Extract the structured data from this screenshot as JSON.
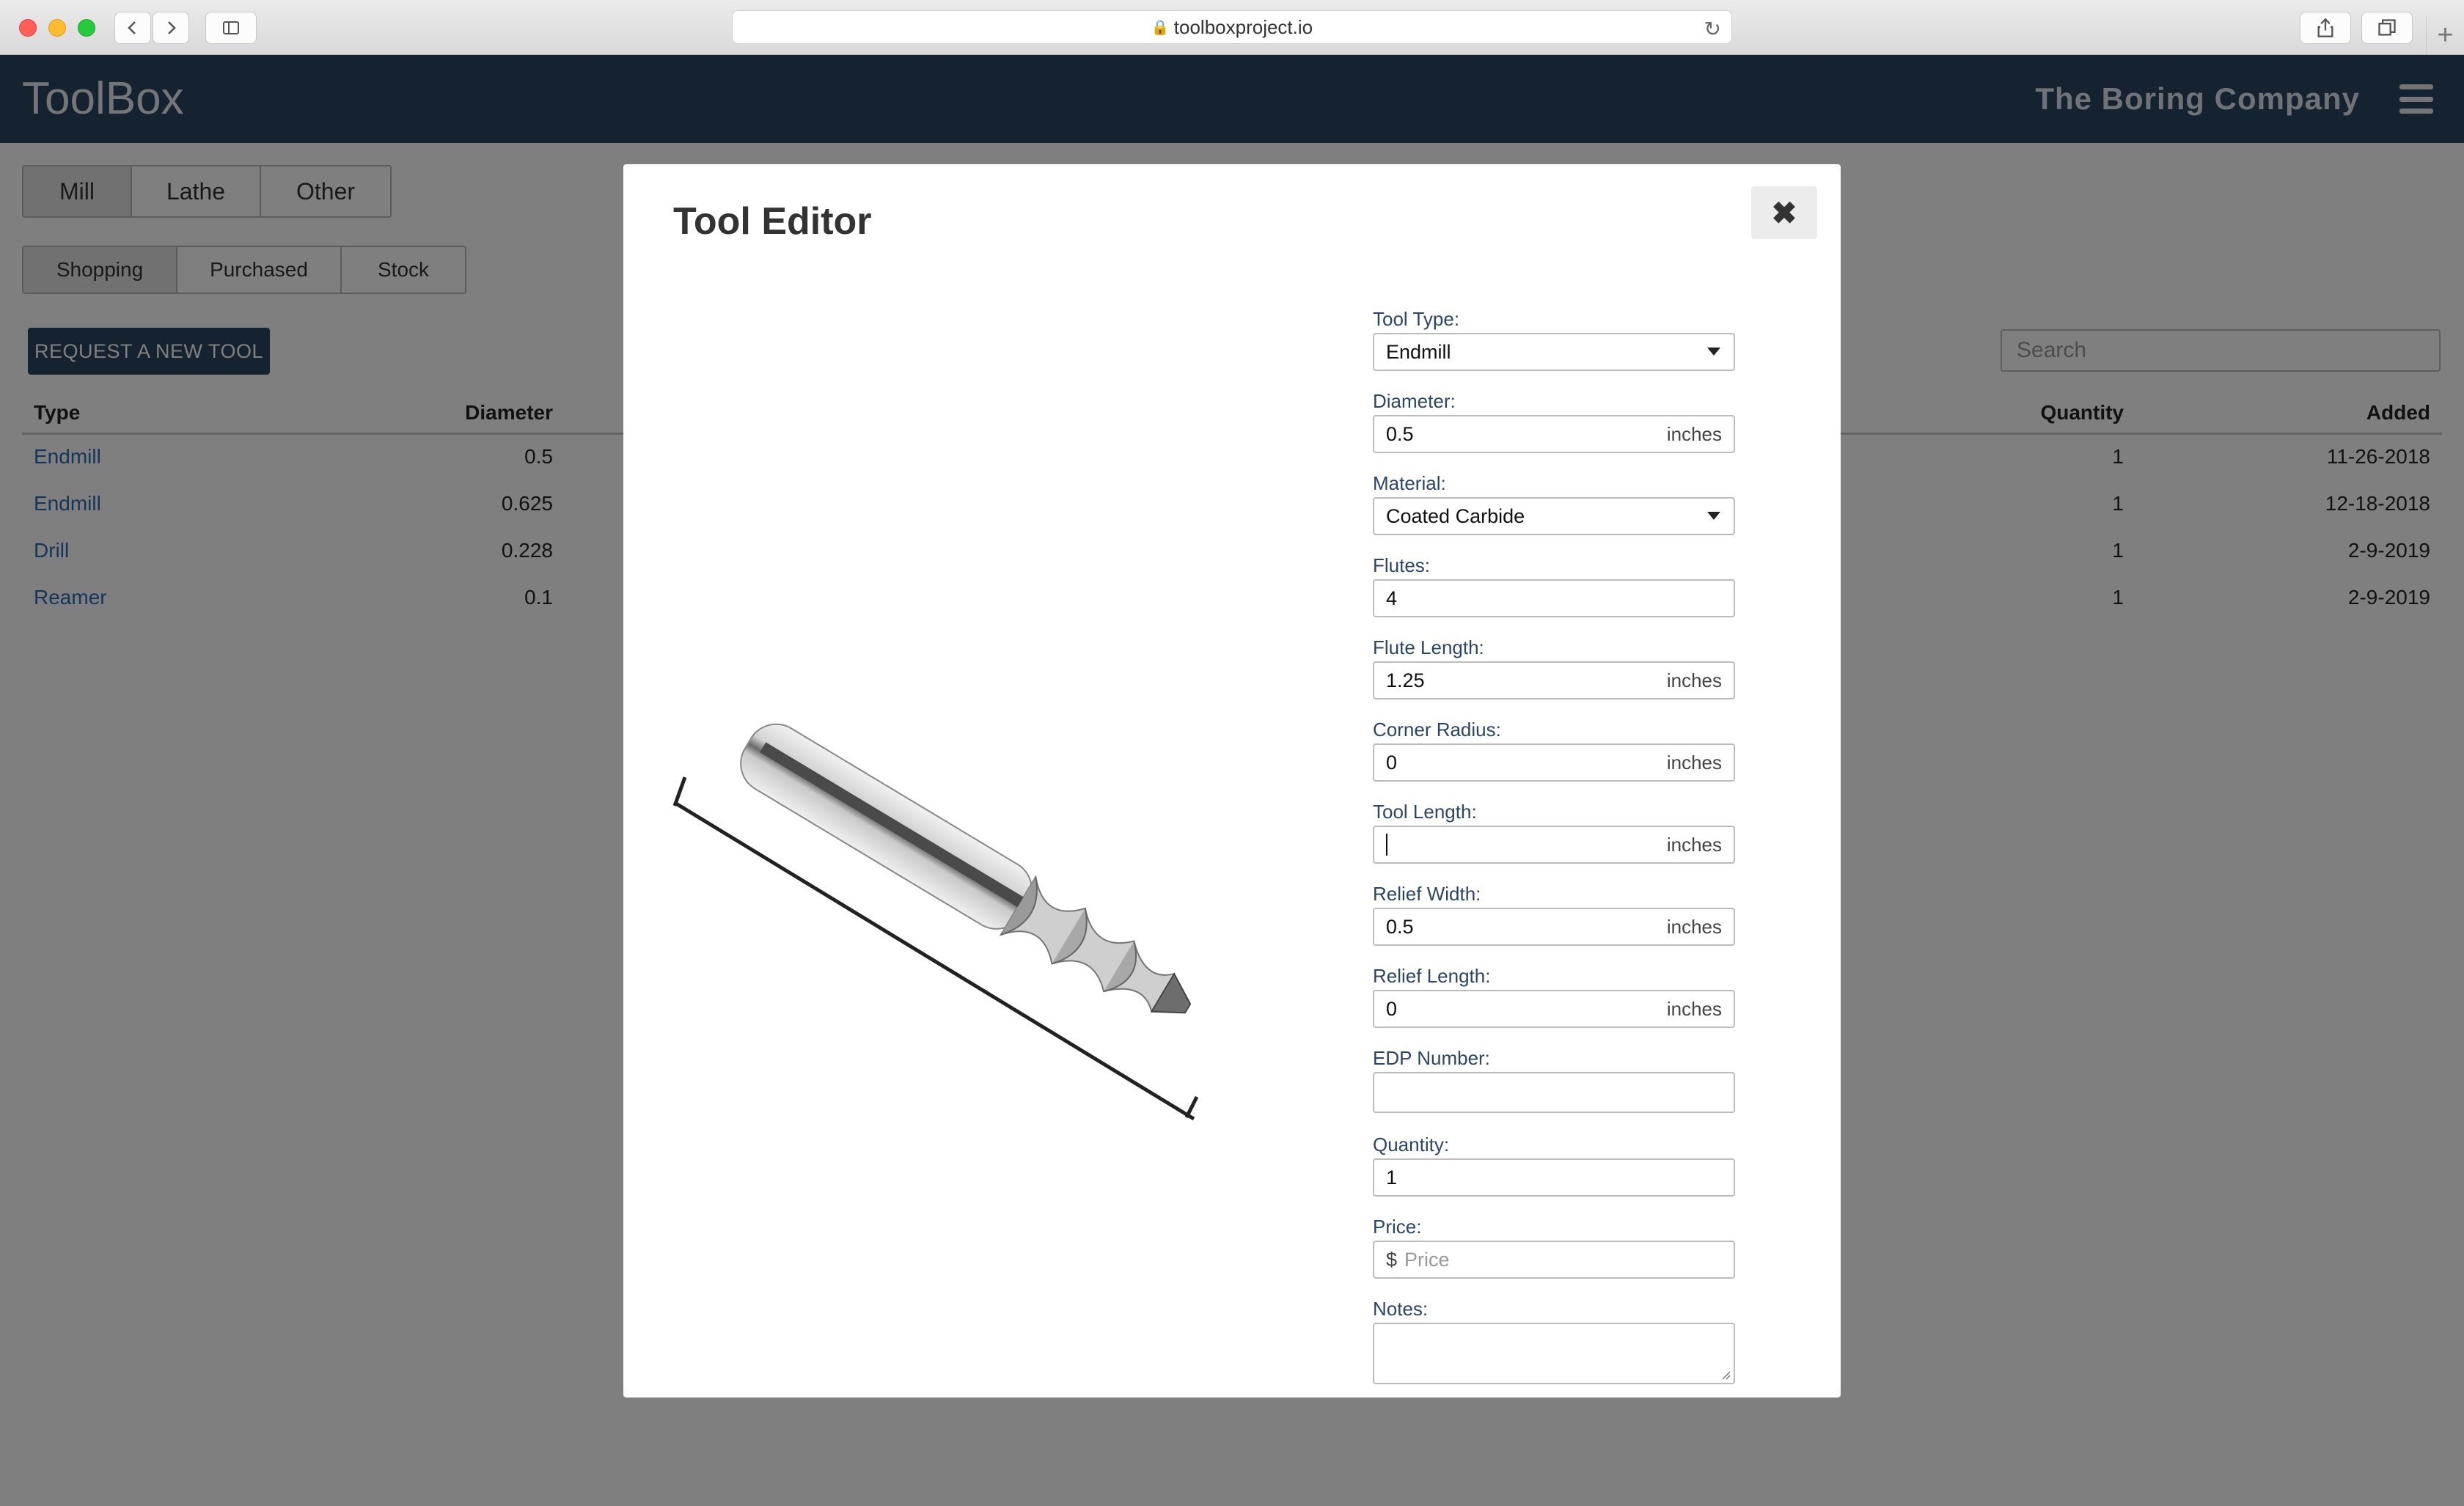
{
  "browser": {
    "url": "toolboxproject.io"
  },
  "header": {
    "brand": "ToolBox",
    "company": "The Boring Company"
  },
  "tabs": {
    "machine": [
      "Mill",
      "Lathe",
      "Other"
    ],
    "status": [
      "Shopping",
      "Purchased",
      "Stock"
    ]
  },
  "actions": {
    "request_label": "REQUEST A NEW TOOL",
    "search_placeholder": "Search"
  },
  "table": {
    "columns": {
      "type": "Type",
      "diameter": "Diameter",
      "quantity": "Quantity",
      "added": "Added"
    },
    "rows": [
      {
        "type": "Endmill",
        "diameter": "0.5",
        "quantity": "1",
        "added": "11-26-2018"
      },
      {
        "type": "Endmill",
        "diameter": "0.625",
        "quantity": "1",
        "added": "12-18-2018"
      },
      {
        "type": "Drill",
        "diameter": "0.228",
        "quantity": "1",
        "added": "2-9-2019"
      },
      {
        "type": "Reamer",
        "diameter": "0.1",
        "quantity": "1",
        "added": "2-9-2019"
      }
    ]
  },
  "modal": {
    "title": "Tool Editor",
    "close_icon": "close-icon",
    "fields": {
      "tool_type": {
        "label": "Tool Type:",
        "value": "Endmill"
      },
      "diameter": {
        "label": "Diameter:",
        "value": "0.5",
        "unit": "inches"
      },
      "material": {
        "label": "Material:",
        "value": "Coated Carbide"
      },
      "flutes": {
        "label": "Flutes:",
        "value": "4"
      },
      "flute_length": {
        "label": "Flute Length:",
        "value": "1.25",
        "unit": "inches"
      },
      "corner_radius": {
        "label": "Corner Radius:",
        "value": "0",
        "unit": "inches"
      },
      "tool_length": {
        "label": "Tool Length:",
        "value": "",
        "unit": "inches"
      },
      "relief_width": {
        "label": "Relief Width:",
        "value": "0.5",
        "unit": "inches"
      },
      "relief_length": {
        "label": "Relief Length:",
        "value": "0",
        "unit": "inches"
      },
      "edp_number": {
        "label": "EDP Number:",
        "value": ""
      },
      "quantity": {
        "label": "Quantity:",
        "value": "1"
      },
      "price": {
        "label": "Price:",
        "prefix": "$",
        "placeholder": "Price"
      },
      "notes": {
        "label": "Notes:",
        "value": ""
      }
    }
  }
}
